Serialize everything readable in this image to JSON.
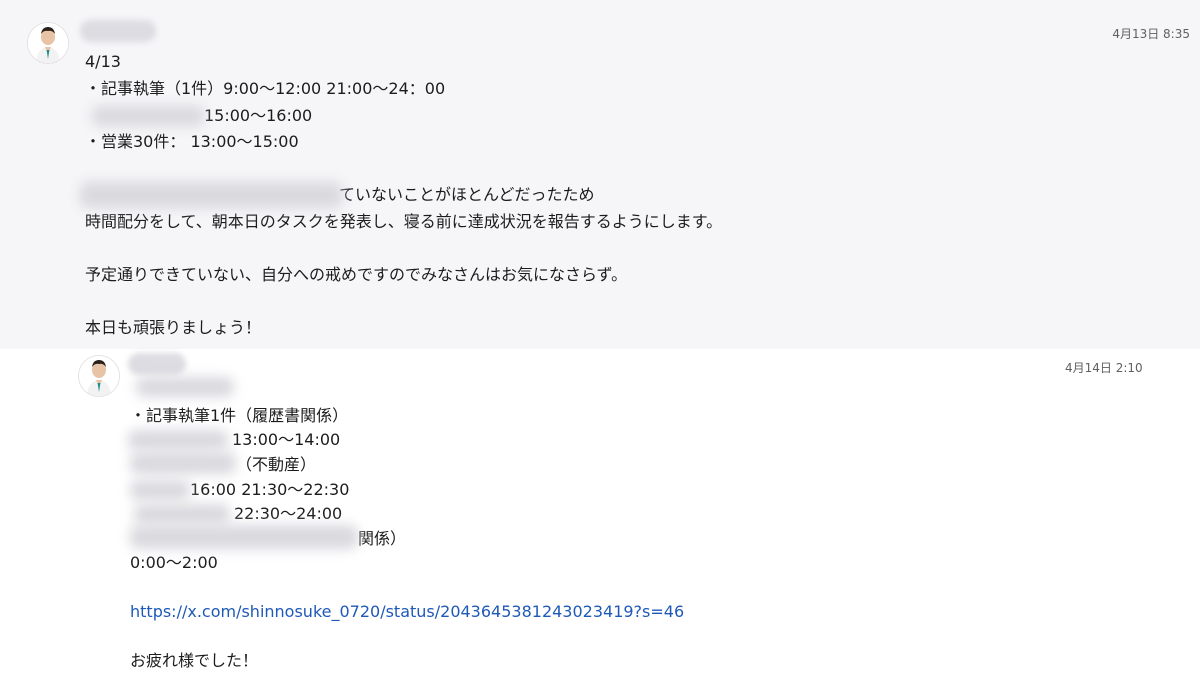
{
  "messages": [
    {
      "timestamp": "4月13日 8:35",
      "lines": [
        "4/13",
        "・記事執筆（1件）9:00〜12:00  21:00〜24：00",
        "15:00〜16:00",
        "・営業30件： 13:00〜15:00",
        "ていないことがほとんどだったため",
        "時間配分をして、朝本日のタスクを発表し、寝る前に達成状況を報告するようにします。",
        "予定通りできていない、自分への戒めですのでみなさんはお気になさらず。",
        "本日も頑張りましょう！"
      ]
    },
    {
      "timestamp": "4月14日 2:10",
      "lines": [
        "・記事執筆1件（履歴書関係）",
        "13:00〜14:00",
        "（不動産）",
        "16:00 21:30〜22:30",
        "22:30〜24:00",
        "関係）",
        "0:00〜2:00",
        "https://x.com/shinnosuke_0720/status/2043645381243023419?s=46",
        "お疲れ様でした！"
      ]
    }
  ]
}
